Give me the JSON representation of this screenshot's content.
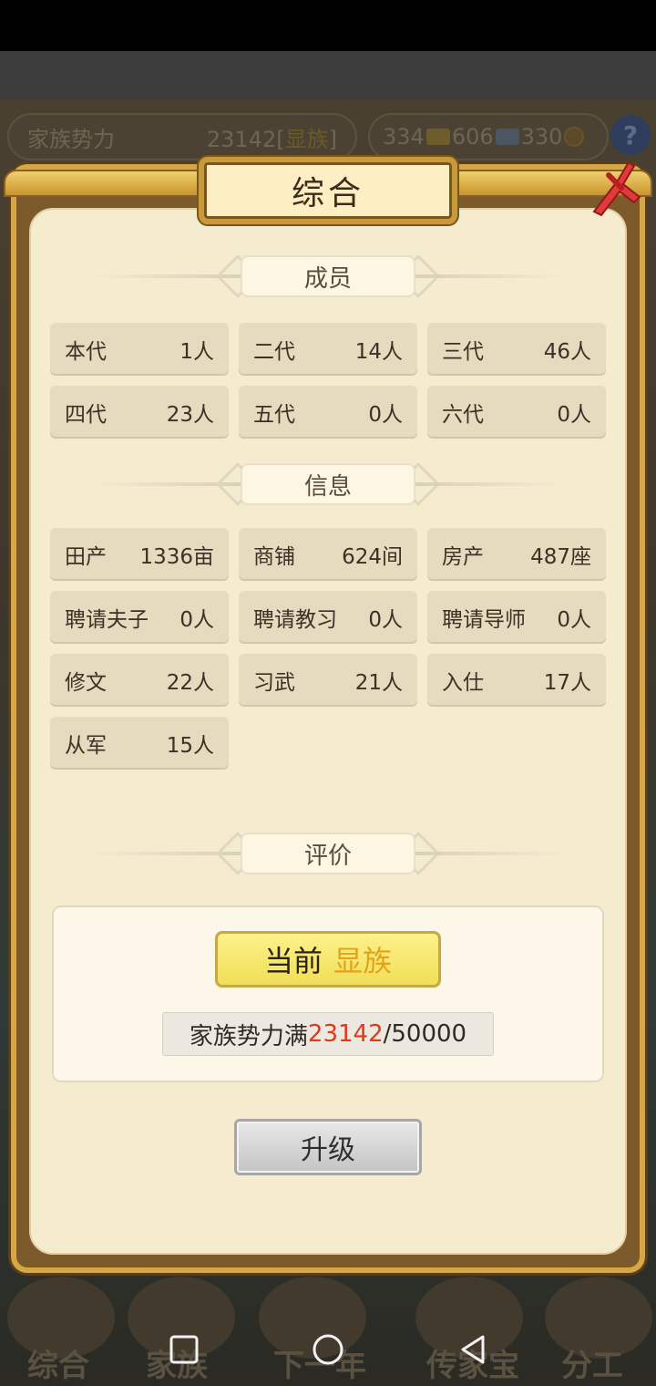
{
  "background": {
    "family_power_label": "家族势力",
    "family_power_value": "23142",
    "family_power_rank": "显族",
    "resources": [
      "334",
      "606",
      "330"
    ],
    "help_glyph": "?",
    "bottom_nav": [
      "综合",
      "家族",
      "下一年",
      "传家宝",
      "分工"
    ]
  },
  "dialog": {
    "title": "综合",
    "sections": {
      "members_title": "成员",
      "info_title": "信息",
      "eval_title": "评价"
    },
    "members": [
      {
        "label": "本代",
        "value": "1人"
      },
      {
        "label": "二代",
        "value": "14人"
      },
      {
        "label": "三代",
        "value": "46人"
      },
      {
        "label": "四代",
        "value": "23人"
      },
      {
        "label": "五代",
        "value": "0人"
      },
      {
        "label": "六代",
        "value": "0人"
      }
    ],
    "info": [
      {
        "label": "田产",
        "value": "1336亩"
      },
      {
        "label": "商铺",
        "value": "624间"
      },
      {
        "label": "房产",
        "value": "487座"
      },
      {
        "label": "聘请夫子",
        "value": "0人"
      },
      {
        "label": "聘请教习",
        "value": "0人"
      },
      {
        "label": "聘请导师",
        "value": "0人"
      },
      {
        "label": "修文",
        "value": "22人"
      },
      {
        "label": "习武",
        "value": "21人"
      },
      {
        "label": "入仕",
        "value": "17人"
      },
      {
        "label": "从军",
        "value": "15人"
      }
    ],
    "evaluation": {
      "current_label": "当前",
      "current_rank": "显族",
      "progress_label": "家族势力满",
      "progress_current": "23142",
      "progress_separator": "/",
      "progress_max": "50000"
    },
    "upgrade_label": "升级"
  },
  "colors": {
    "rank_text": "#e3a21a",
    "progress_current": "#e0391c",
    "panel_bg": "#f5ecd0",
    "cell_bg": "#e6dbbe",
    "frame_gold": "#d8a745"
  }
}
